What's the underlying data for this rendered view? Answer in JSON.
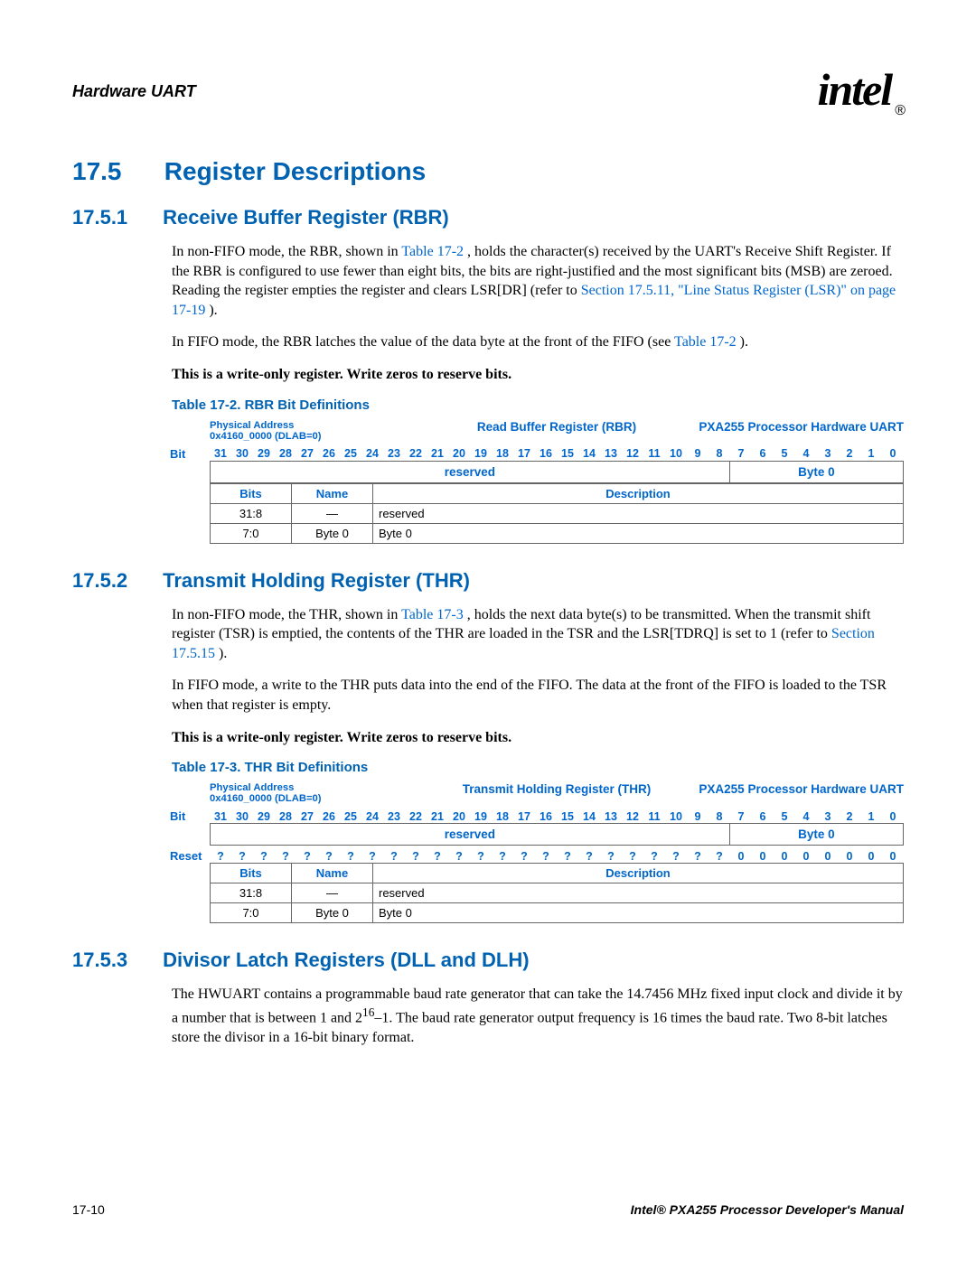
{
  "header": {
    "section": "Hardware UART",
    "brand": "intel",
    "reg_mark": "®"
  },
  "footer": {
    "page": "17-10",
    "doc": "Intel® PXA255 Processor Developer's Manual"
  },
  "h17_5": {
    "num": "17.5",
    "title": "Register Descriptions"
  },
  "s17_5_1": {
    "num": "17.5.1",
    "title": "Receive Buffer Register (RBR)",
    "p1a": "In non-FIFO mode, the RBR, shown in ",
    "p1_link1": "Table 17-2",
    "p1b": ", holds the character(s) received by the UART's Receive Shift Register. If the RBR is configured to use fewer than eight bits, the bits are right-justified and the most significant bits (MSB) are zeroed. Reading the register empties the register and clears LSR[DR] (refer to ",
    "p1_link2": "Section 17.5.11, \"Line Status Register (LSR)\" on page 17-19",
    "p1c": ").",
    "p2a": "In FIFO mode, the RBR latches the value of the data byte at the front of the FIFO (see ",
    "p2_link": "Table 17-2",
    "p2b": ").",
    "p3": "This is a write-only register. Write zeros to reserve bits."
  },
  "tbl17_2": {
    "caption": "Table 17-2. RBR Bit Definitions",
    "addr_label": "Physical Address",
    "addr": "0x4160_0000 (DLAB=0)",
    "regname": "Read Buffer Register (RBR)",
    "chip": "PXA255 Processor Hardware UART",
    "bit_label": "Bit",
    "bits": [
      "31",
      "30",
      "29",
      "28",
      "27",
      "26",
      "25",
      "24",
      "23",
      "22",
      "21",
      "20",
      "19",
      "18",
      "17",
      "16",
      "15",
      "14",
      "13",
      "12",
      "11",
      "10",
      "9",
      "8",
      "7",
      "6",
      "5",
      "4",
      "3",
      "2",
      "1",
      "0"
    ],
    "field_reserved": "reserved",
    "field_byte0": "Byte 0",
    "cols": {
      "bits": "Bits",
      "name": "Name",
      "desc": "Description"
    },
    "rows": [
      {
        "bits": "31:8",
        "name": "—",
        "desc": "reserved"
      },
      {
        "bits": "7:0",
        "name": "Byte 0",
        "desc": "Byte 0"
      }
    ]
  },
  "s17_5_2": {
    "num": "17.5.2",
    "title": "Transmit Holding Register (THR)",
    "p1a": "In non-FIFO mode, the THR, shown in ",
    "p1_link1": "Table 17-3",
    "p1b": ", holds the next data byte(s) to be transmitted. When the transmit shift register (TSR) is emptied, the contents of the THR are loaded in the TSR and the LSR[TDRQ] is set to 1 (refer to ",
    "p1_link2": "Section 17.5.15",
    "p1c": ").",
    "p2": "In FIFO mode, a write to the THR puts data into the end of the FIFO. The data at the front of the FIFO is loaded to the TSR when that register is empty.",
    "p3": "This is a write-only register. Write zeros to reserve bits."
  },
  "tbl17_3": {
    "caption": "Table 17-3. THR Bit Definitions",
    "addr_label": "Physical Address",
    "addr": "0x4160_0000 (DLAB=0)",
    "regname": "Transmit Holding Register (THR)",
    "chip": "PXA255 Processor Hardware UART",
    "bit_label": "Bit",
    "bits": [
      "31",
      "30",
      "29",
      "28",
      "27",
      "26",
      "25",
      "24",
      "23",
      "22",
      "21",
      "20",
      "19",
      "18",
      "17",
      "16",
      "15",
      "14",
      "13",
      "12",
      "11",
      "10",
      "9",
      "8",
      "7",
      "6",
      "5",
      "4",
      "3",
      "2",
      "1",
      "0"
    ],
    "field_reserved": "reserved",
    "field_byte0": "Byte 0",
    "reset_label": "Reset",
    "reset": [
      "?",
      "?",
      "?",
      "?",
      "?",
      "?",
      "?",
      "?",
      "?",
      "?",
      "?",
      "?",
      "?",
      "?",
      "?",
      "?",
      "?",
      "?",
      "?",
      "?",
      "?",
      "?",
      "?",
      "?",
      "0",
      "0",
      "0",
      "0",
      "0",
      "0",
      "0",
      "0"
    ],
    "cols": {
      "bits": "Bits",
      "name": "Name",
      "desc": "Description"
    },
    "rows": [
      {
        "bits": "31:8",
        "name": "—",
        "desc": "reserved"
      },
      {
        "bits": "7:0",
        "name": "Byte 0",
        "desc": "Byte 0"
      }
    ]
  },
  "s17_5_3": {
    "num": "17.5.3",
    "title": "Divisor Latch Registers (DLL and DLH)",
    "p1": "The HWUART contains a programmable baud rate generator that can take the 14.7456 MHz fixed input clock and divide it by a number that is between 1 and 2",
    "p1_sup": "16",
    "p1b": "–1. The baud rate generator output frequency is 16 times the baud rate. Two 8-bit latches store the divisor in a 16-bit binary format."
  }
}
